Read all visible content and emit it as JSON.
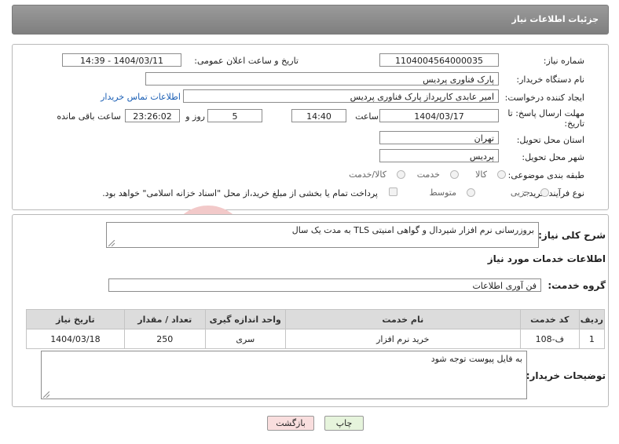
{
  "page_title": "جزئیات اطلاعات نیاز",
  "fields": {
    "need_number_label": "شماره نیاز:",
    "need_number": "1104004564000035",
    "announce_label": "تاریخ و ساعت اعلان عمومی:",
    "announce_value": "1404/03/11 - 14:39",
    "buyer_org_label": "نام دستگاه خریدار:",
    "buyer_org": "پارک فناوری پردیس",
    "creator_label": "ایجاد کننده درخواست:",
    "creator": "امیر عابدی کارپرداز پارک فناوری پردیس",
    "contact_link": "اطلاعات تماس خریدار",
    "deadline_label_1": "مهلت ارسال پاسخ: تا",
    "deadline_label_2": "تاریخ:",
    "deadline_date": "1404/03/17",
    "time_label": "ساعت",
    "deadline_time": "14:40",
    "days_value": "5",
    "days_label": "روز و",
    "remaining_time": "23:26:02",
    "remaining_label": "ساعت باقی مانده",
    "province_label": "استان محل تحویل:",
    "province": "تهران",
    "city_label": "شهر محل تحویل:",
    "city": "پردیس",
    "category_label": "طبقه بندی موضوعی:",
    "category_options": [
      "کالا",
      "خدمت",
      "کالا/خدمت"
    ],
    "process_label": "نوع فرآیند خرید :",
    "process_options": [
      "جزیی",
      "متوسط"
    ],
    "payment_note": "پرداخت تمام یا بخشی از مبلغ خرید،از محل \"اسناد خزانه اسلامی\" خواهد بود."
  },
  "summary": {
    "label": "شرح کلی نیاز:",
    "text": "بروزرسانی نرم افزار شیردال و گواهی امنیتی TLS به مدت یک سال"
  },
  "services": {
    "section_title": "اطلاعات خدمات مورد نیاز",
    "group_label": "گروه خدمت:",
    "group_value": "فن آوری اطلاعات",
    "columns": [
      "ردیف",
      "کد خدمت",
      "نام خدمت",
      "واحد اندازه گیری",
      "تعداد / مقدار",
      "تاریخ نیاز"
    ],
    "rows": [
      [
        "1",
        "ف-108",
        "خرید نرم افزار",
        "سری",
        "250",
        "1404/03/18"
      ]
    ]
  },
  "buyer_notes": {
    "label": "توضیحات خریدار:",
    "text": "به فایل پیوست توجه شود"
  },
  "buttons": {
    "print": "چاپ",
    "back": "بازگشت"
  },
  "watermark": "AriaTender.neT",
  "colors": {
    "link": "#1b5fb5",
    "back_button_bg": "#f9dede",
    "print_button_bg": "#e6f4dc",
    "watermark": "#f2c9c9"
  }
}
